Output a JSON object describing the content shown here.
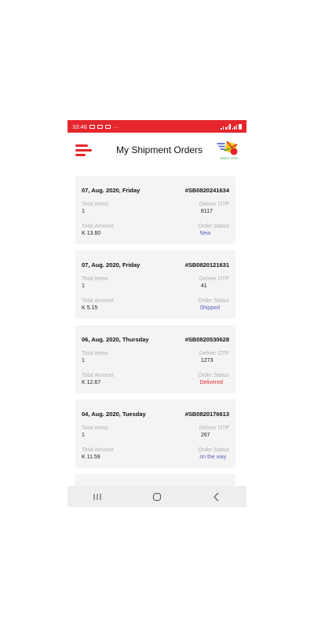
{
  "status_bar": {
    "time": "10:46",
    "dots": "···",
    "background": "#e5262d"
  },
  "header": {
    "title": "My Shipment Orders",
    "logo_text": "SWEET OTEC",
    "accent": "#e5262d"
  },
  "labels": {
    "total_items": "Total Items",
    "deliver_otp": "Deliver OTP",
    "total_amount": "Total Amount",
    "order_status": "Order Status"
  },
  "orders": [
    {
      "date": "07, Aug. 2020, Friday",
      "id": "#SB0820241634",
      "items": "1",
      "otp": "8117",
      "amount": "K 13.60",
      "status": "New",
      "status_color": "#5a5fb5"
    },
    {
      "date": "07, Aug. 2020, Friday",
      "id": "#SB0820121631",
      "items": "1",
      "otp": "41",
      "amount": "K 5.15",
      "status": "Shipped",
      "status_color": "#5a5fb5"
    },
    {
      "date": "06, Aug. 2020, Thursday",
      "id": "#SB0820530628",
      "items": "1",
      "otp": "1273",
      "amount": "K 12.67",
      "status": "Delivered",
      "status_color": "#e02a2a"
    },
    {
      "date": "04, Aug. 2020, Tuesday",
      "id": "#SB0820176613",
      "items": "1",
      "otp": "267",
      "amount": "K 11.59",
      "status": "on the way",
      "status_color": "#5a5fb5"
    }
  ],
  "nav": {
    "recent": "recents-icon",
    "home": "home-icon",
    "back": "back-icon"
  }
}
